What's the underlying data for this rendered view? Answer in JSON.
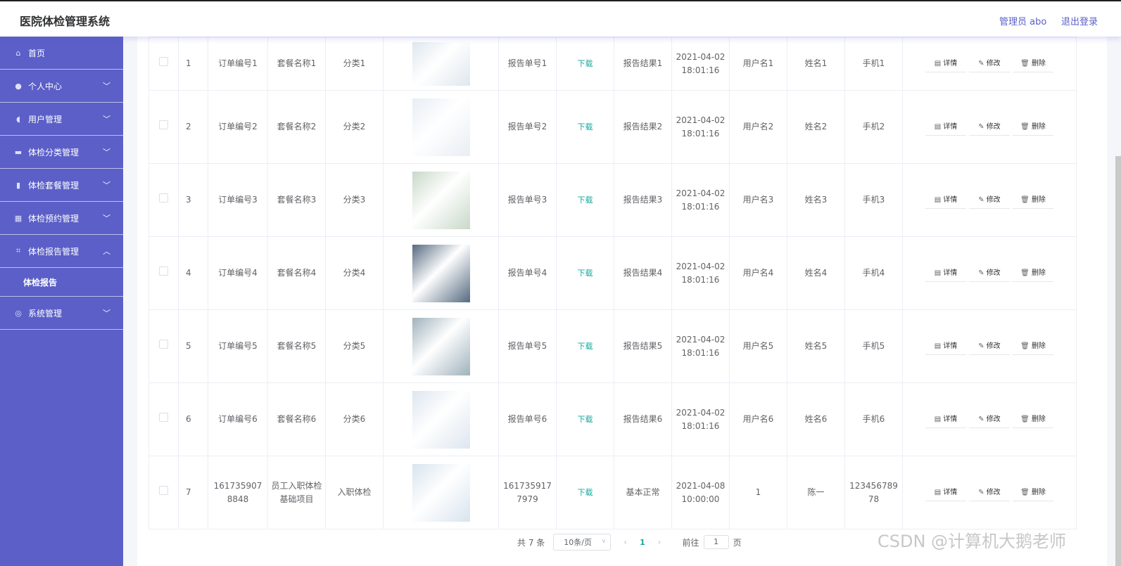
{
  "app": {
    "title": "医院体检管理系统"
  },
  "header": {
    "user": "管理员 abo",
    "logout": "退出登录"
  },
  "sidebar": {
    "items": [
      {
        "label": "首页",
        "icon": "home-icon",
        "expandable": false
      },
      {
        "label": "个人中心",
        "icon": "user-icon",
        "expandable": true
      },
      {
        "label": "用户管理",
        "icon": "microphone-icon",
        "expandable": true
      },
      {
        "label": "体检分类管理",
        "icon": "monitor-icon",
        "expandable": true
      },
      {
        "label": "体检套餐管理",
        "icon": "bar-chart-icon",
        "expandable": true
      },
      {
        "label": "体检预约管理",
        "icon": "grid-icon",
        "expandable": true
      },
      {
        "label": "体检报告管理",
        "icon": "crop-icon",
        "expandable": true,
        "expanded": true
      },
      {
        "label": "体检报告",
        "submenu": true
      },
      {
        "label": "系统管理",
        "icon": "settings-icon",
        "expandable": true
      }
    ]
  },
  "table": {
    "rows": [
      {
        "no": "1",
        "order": "订单编号1",
        "package": "套餐名称1",
        "category": "分类1",
        "report_no": "报告单号1",
        "download": "下载",
        "result": "报告结果1",
        "date": "2021-04-02",
        "time": "18:01:16",
        "username": "用户名1",
        "name": "姓名1",
        "phone": "手机1"
      },
      {
        "no": "2",
        "order": "订单编号2",
        "package": "套餐名称2",
        "category": "分类2",
        "report_no": "报告单号2",
        "download": "下载",
        "result": "报告结果2",
        "date": "2021-04-02",
        "time": "18:01:16",
        "username": "用户名2",
        "name": "姓名2",
        "phone": "手机2"
      },
      {
        "no": "3",
        "order": "订单编号3",
        "package": "套餐名称3",
        "category": "分类3",
        "report_no": "报告单号3",
        "download": "下载",
        "result": "报告结果3",
        "date": "2021-04-02",
        "time": "18:01:16",
        "username": "用户名3",
        "name": "姓名3",
        "phone": "手机3"
      },
      {
        "no": "4",
        "order": "订单编号4",
        "package": "套餐名称4",
        "category": "分类4",
        "report_no": "报告单号4",
        "download": "下载",
        "result": "报告结果4",
        "date": "2021-04-02",
        "time": "18:01:16",
        "username": "用户名4",
        "name": "姓名4",
        "phone": "手机4"
      },
      {
        "no": "5",
        "order": "订单编号5",
        "package": "套餐名称5",
        "category": "分类5",
        "report_no": "报告单号5",
        "download": "下载",
        "result": "报告结果5",
        "date": "2021-04-02",
        "time": "18:01:16",
        "username": "用户名5",
        "name": "姓名5",
        "phone": "手机5"
      },
      {
        "no": "6",
        "order": "订单编号6",
        "package": "套餐名称6",
        "category": "分类6",
        "report_no": "报告单号6",
        "download": "下载",
        "result": "报告结果6",
        "date": "2021-04-02",
        "time": "18:01:16",
        "username": "用户名6",
        "name": "姓名6",
        "phone": "手机6"
      },
      {
        "no": "7",
        "order": "1617359078848",
        "package": "员工入职体检基础项目",
        "category": "入职体检",
        "report_no": "1617359177979",
        "download": "下载",
        "result": "基本正常",
        "date": "2021-04-08",
        "time": "10:00:00",
        "username": "1",
        "name": "陈一",
        "phone": "12345678978"
      }
    ],
    "actions": {
      "detail": "详情",
      "edit": "修改",
      "delete": "删除"
    },
    "thumb_colors": [
      "#dfe7ee",
      "#e8eef4",
      "#c9d8c8",
      "#556a80",
      "#9fb2bc",
      "#dde6ef",
      "#d8e4ee"
    ]
  },
  "pagination": {
    "total": "共 7 条",
    "page_size": "10条/页",
    "current_page": "1",
    "goto_label": "前往",
    "goto_value": "1",
    "page_suffix": "页"
  },
  "watermark": "CSDN @计算机大鹅老师"
}
